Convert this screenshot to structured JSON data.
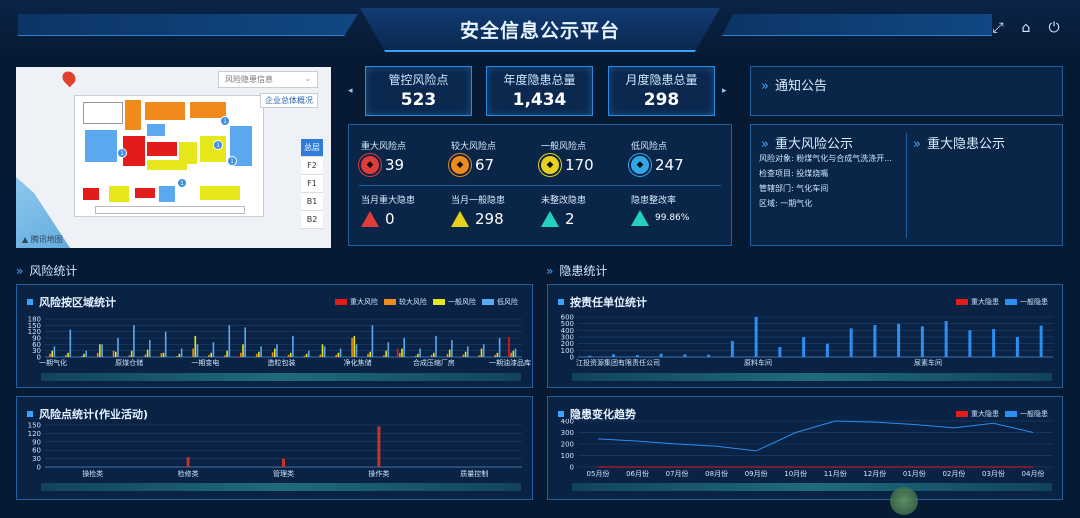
{
  "header": {
    "title": "安全信息公示平台",
    "buttons": [
      {
        "name": "fullscreen-icon",
        "glyph": "⤢"
      },
      {
        "name": "home-icon",
        "glyph": "⌂"
      },
      {
        "name": "logout-icon",
        "glyph": "⏻"
      }
    ]
  },
  "map": {
    "select_value": "风险隐患信息",
    "overview_button": "企业总体概况",
    "floors": [
      "总层",
      "F2",
      "F1",
      "B1",
      "B2"
    ],
    "active_floor": "总层",
    "logo_text": "腾讯地图",
    "pins": [
      "1",
      "1",
      "1",
      "1",
      "1"
    ]
  },
  "kpis": [
    {
      "label": "管控风险点",
      "value": "523"
    },
    {
      "label": "年度隐患总量",
      "value": "1,434"
    },
    {
      "label": "月度隐患总量",
      "value": "298"
    }
  ],
  "nav": {
    "prev": "◂",
    "next": "▸"
  },
  "stats": [
    {
      "label": "重大风险点",
      "value": "39",
      "color": "#e23b3b",
      "icon": "shield-red-icon"
    },
    {
      "label": "较大风险点",
      "value": "67",
      "color": "#f08a1c",
      "icon": "shield-orange-icon"
    },
    {
      "label": "一般风险点",
      "value": "170",
      "color": "#e6d21c",
      "icon": "shield-yellow-icon"
    },
    {
      "label": "低风险点",
      "value": "247",
      "color": "#2fa6e8",
      "icon": "shield-blue-icon"
    },
    {
      "label": "当月重大隐患",
      "value": "0",
      "color": "#e23b3b",
      "icon": "warning-red-icon"
    },
    {
      "label": "当月一般隐患",
      "value": "298",
      "color": "#e6d21c",
      "icon": "warning-yellow-icon"
    },
    {
      "label": "未整改隐患",
      "value": "2",
      "color": "#23d1c0",
      "icon": "warning-cyan-icon"
    },
    {
      "label": "隐患整改率",
      "value": "99.86%",
      "color": "#23d1c0",
      "icon": "rate-cyan-icon"
    }
  ],
  "notice": {
    "title": "通知公告"
  },
  "major_risk": {
    "title": "重大风险公示",
    "lines": [
      "风险对象: 粉煤气化与合成气洗涤开...",
      "检查项目: 投煤烧嘴",
      "管辖部门: 气化车间",
      "区域: 一期气化"
    ]
  },
  "major_hazard": {
    "title": "重大隐患公示"
  },
  "sections": {
    "risk": "风险统计",
    "hazard": "隐患统计"
  },
  "charts": {
    "area": {
      "title": "风险按区域统计",
      "legend": [
        "重大风险",
        "较大风险",
        "一般风险",
        "低风险"
      ]
    },
    "activity": {
      "title": "风险点统计(作业活动)"
    },
    "dept": {
      "title": "按责任单位统计",
      "legend": [
        "重大隐患",
        "一般隐患"
      ]
    },
    "trend": {
      "title": "隐患变化趋势",
      "legend": [
        "重大隐患",
        "一般隐患"
      ]
    }
  },
  "colors": {
    "major": "#e21b1b",
    "large": "#f08a1c",
    "general": "#e6e61c",
    "low": "#5aa9f0",
    "hazard_general": "#2b8ef0"
  },
  "chart_data": [
    {
      "type": "bar",
      "title": "风险按区域统计",
      "ylim": [
        0,
        180
      ],
      "yticks": [
        0,
        30,
        60,
        90,
        120,
        150,
        180
      ],
      "tick_labels": [
        "一期气化",
        "原煤仓储",
        "一期变电",
        "造粒包装",
        "净化焦储",
        "合成压缩厂房",
        "一期油漆品库"
      ],
      "series": [
        {
          "name": "重大风险",
          "values": [
            2,
            0,
            0,
            3,
            0,
            0,
            0,
            2,
            0,
            0,
            0,
            0,
            5,
            0,
            0,
            0,
            0,
            0,
            0,
            0,
            0,
            0,
            40,
            0,
            0,
            0,
            0,
            0,
            0,
            95
          ]
        },
        {
          "name": "较大风险",
          "values": [
            15,
            10,
            5,
            20,
            30,
            8,
            12,
            18,
            5,
            40,
            10,
            8,
            20,
            15,
            22,
            10,
            6,
            12,
            10,
            90,
            15,
            8,
            20,
            5,
            10,
            15,
            12,
            8,
            10,
            20
          ]
        },
        {
          "name": "一般风险",
          "values": [
            30,
            20,
            15,
            60,
            25,
            30,
            35,
            20,
            15,
            100,
            20,
            30,
            60,
            25,
            40,
            20,
            15,
            60,
            20,
            100,
            25,
            30,
            40,
            15,
            20,
            35,
            25,
            40,
            20,
            30
          ]
        },
        {
          "name": "低风险",
          "values": [
            50,
            130,
            30,
            60,
            90,
            150,
            80,
            120,
            40,
            60,
            70,
            150,
            140,
            50,
            60,
            100,
            30,
            50,
            40,
            60,
            150,
            70,
            90,
            40,
            100,
            80,
            50,
            60,
            90,
            40
          ]
        }
      ]
    },
    {
      "type": "bar",
      "title": "风险点统计(作业活动)",
      "ylim": [
        0,
        150
      ],
      "yticks": [
        0,
        30,
        60,
        90,
        120,
        150
      ],
      "categories": [
        "操检类",
        "检修类",
        "管理类",
        "操作类",
        "质量控制"
      ],
      "series": [
        {
          "name": "重大风险",
          "values": [
            0,
            35,
            30,
            145,
            0
          ]
        }
      ]
    },
    {
      "type": "bar",
      "title": "按责任单位统计",
      "ylim": [
        0,
        600
      ],
      "yticks": [
        0,
        100,
        200,
        300,
        400,
        500,
        600
      ],
      "tick_labels": [
        "江投资源集团有限责任公司",
        "原料车间",
        "尿素车间"
      ],
      "series": [
        {
          "name": "重大隐患",
          "values": [
            0,
            0,
            0,
            0,
            0,
            0,
            0,
            0,
            0,
            0,
            0,
            0,
            0,
            0,
            0,
            0,
            0,
            0,
            0,
            0
          ]
        },
        {
          "name": "一般隐患",
          "values": [
            20,
            40,
            30,
            50,
            40,
            35,
            240,
            650,
            150,
            300,
            200,
            430,
            480,
            500,
            460,
            540,
            400,
            420,
            300,
            470
          ]
        }
      ]
    },
    {
      "type": "line",
      "title": "隐患变化趋势",
      "ylim": [
        0,
        400
      ],
      "yticks": [
        0,
        50,
        100,
        150,
        200,
        250,
        300,
        350,
        400
      ],
      "categories": [
        "05月份",
        "06月份",
        "07月份",
        "08月份",
        "09月份",
        "10月份",
        "11月份",
        "12月份",
        "01月份",
        "02月份",
        "03月份",
        "04月份"
      ],
      "series": [
        {
          "name": "重大隐患",
          "values": [
            0,
            0,
            0,
            0,
            0,
            0,
            0,
            0,
            0,
            0,
            0,
            0
          ]
        },
        {
          "name": "一般隐患",
          "values": [
            245,
            225,
            200,
            180,
            140,
            300,
            400,
            390,
            370,
            340,
            380,
            300
          ]
        }
      ]
    }
  ]
}
